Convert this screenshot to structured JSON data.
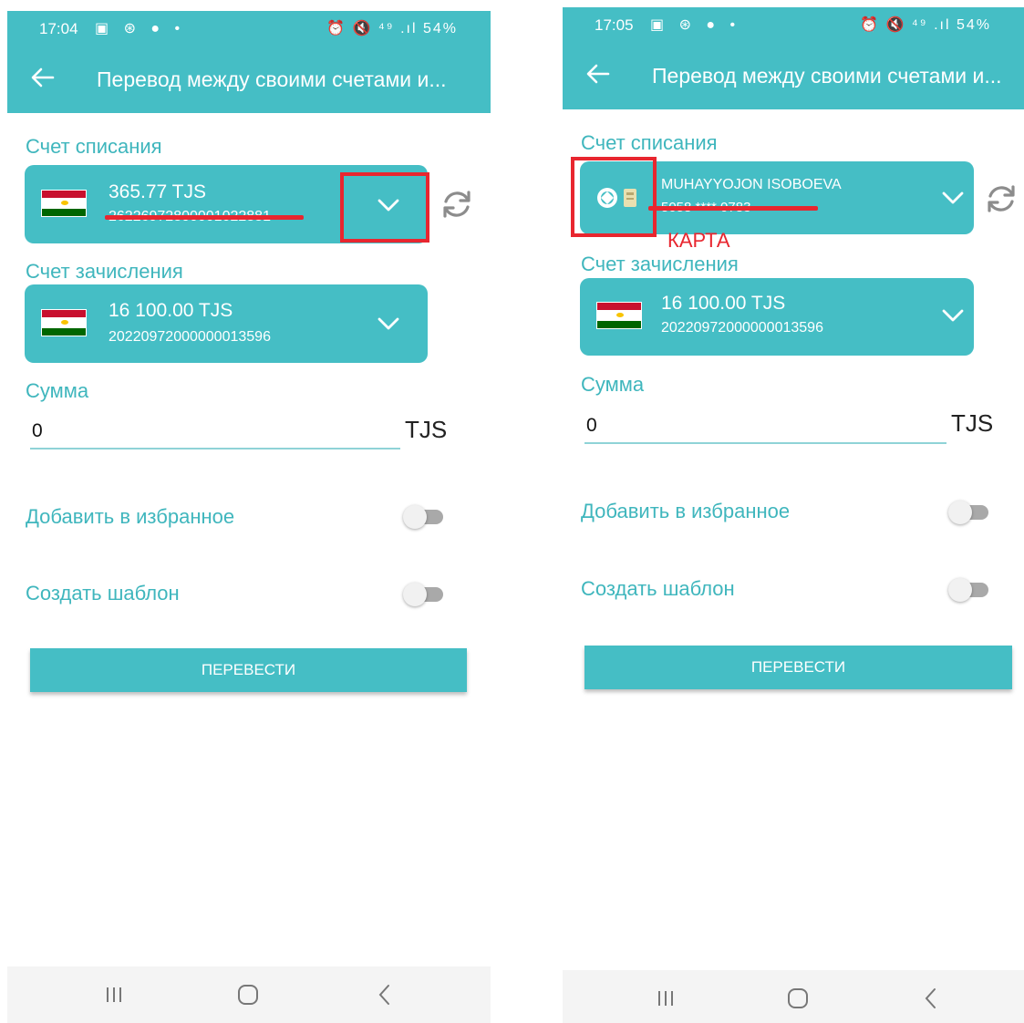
{
  "left": {
    "status": {
      "time": "17:04",
      "icons": "▣ ⊛ ● •",
      "right": "⏰ 🔇 ⁴⁹ .ıl 54%"
    },
    "appbar": {
      "title": "Перевод между своими счетами и..."
    },
    "debit": {
      "label": "Счет списания",
      "amount": "365.77 TJS",
      "account": "26226972800001022881"
    },
    "credit": {
      "label": "Счет зачисления",
      "amount": "16 100.00 TJS",
      "account": "20220972000000013596"
    },
    "sum": {
      "label": "Сумма",
      "value": "0",
      "currency": "TJS"
    },
    "favorite": {
      "label": "Добавить в избранное"
    },
    "template": {
      "label": "Создать шаблон"
    },
    "submit": {
      "label": "ПЕРЕВЕСТИ"
    }
  },
  "right": {
    "status": {
      "time": "17:05",
      "icons": "▣ ⊛ ● •",
      "right": "⏰ 🔇 ⁴⁹ .ıl 54%"
    },
    "appbar": {
      "title": "Перевод между своими счетами и..."
    },
    "debit": {
      "label": "Счет списания",
      "holder": "MUHAYYOJON ISOBOEVA",
      "card_masked": "5058 **** 0783",
      "annotation": "КАРТА"
    },
    "credit": {
      "label": "Счет зачисления",
      "amount": "16 100.00 TJS",
      "account": "20220972000000013596"
    },
    "sum": {
      "label": "Сумма",
      "value": "0",
      "currency": "TJS"
    },
    "favorite": {
      "label": "Добавить в избранное"
    },
    "template": {
      "label": "Создать шаблон"
    },
    "submit": {
      "label": "ПЕРЕВЕСТИ"
    }
  },
  "colors": {
    "accent": "#45bec5",
    "label": "#3fb6bd",
    "annotation": "#e8262f"
  },
  "icons": [
    "back-arrow-icon",
    "chevron-down-icon",
    "refresh-icon",
    "flag-tajikistan-icon",
    "card-logo-icon",
    "menu-icon",
    "home-icon",
    "back-icon"
  ]
}
